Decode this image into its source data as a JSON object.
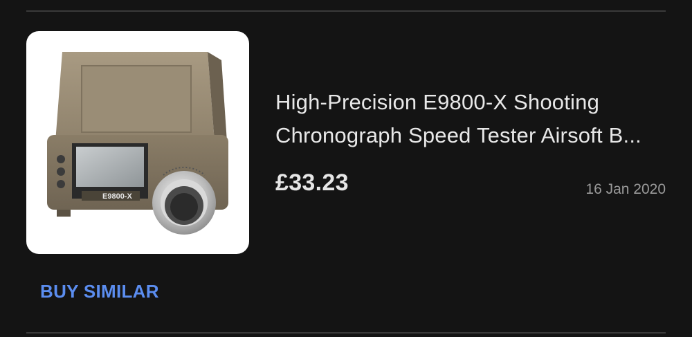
{
  "listing": {
    "title_line1": "High-Precision E9800-X Shooting",
    "title_line2": "Chronograph Speed Tester Airsoft B...",
    "price": "£33.23",
    "date": "16 Jan 2020",
    "buy_similar_label": "BUY SIMILAR",
    "product_image": {
      "device_model_label": "E9800-X"
    }
  },
  "colors": {
    "background": "#141414",
    "accent": "#5b8def",
    "text_primary": "#e8e8e8",
    "text_secondary": "#9a9a9a",
    "divider": "#3a3a3a"
  }
}
